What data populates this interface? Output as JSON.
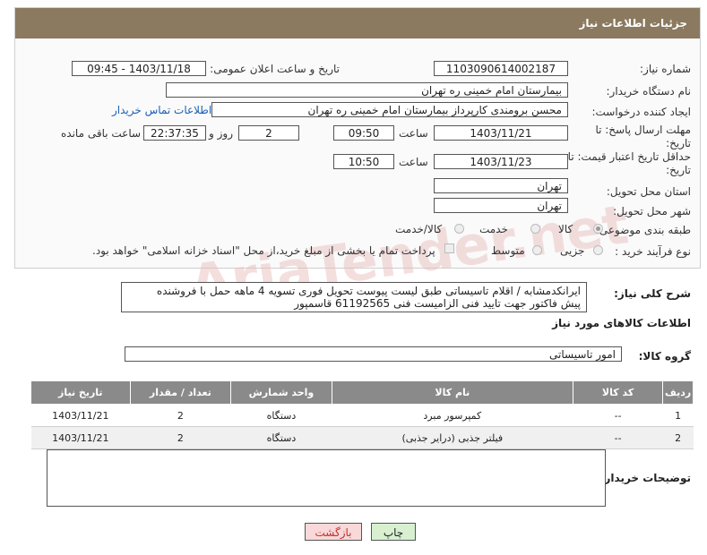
{
  "panel": {
    "title": "جزئیات اطلاعات نیاز"
  },
  "fields": {
    "need_number_label": "شماره نیاز:",
    "need_number": "1103090614002187",
    "announce_label": "تاریخ و ساعت اعلان عمومی:",
    "announce_value": "1403/11/18 - 09:45",
    "buyer_org_label": "نام دستگاه خریدار:",
    "buyer_org": "بیمارستان امام خمینی ره  تهران",
    "creator_label": "ایجاد کننده درخواست:",
    "creator": "محسن برومندی کارپرداز بیمارستان امام خمینی ره  تهران",
    "contact_link": "اطلاعات تماس خریدار",
    "deadline_label_1": "مهلت ارسال پاسخ: تا",
    "deadline_label_2": "تاریخ:",
    "deadline_date": "1403/11/21",
    "time_label": "ساعت",
    "deadline_time": "09:50",
    "days_value": "2",
    "days_label": "روز و",
    "remaining_time": "22:37:35",
    "remaining_label": "ساعت باقی مانده",
    "validity_label_1": "حداقل تاریخ اعتبار قیمت: تا",
    "validity_label_2": "تاریخ:",
    "validity_date": "1403/11/23",
    "validity_time": "10:50",
    "province_label": "استان محل تحویل:",
    "province": "تهران",
    "city_label": "شهر محل تحویل:",
    "city": "تهران",
    "category_label": "طبقه بندی موضوعی:",
    "category_options": [
      "کالا",
      "خدمت",
      "کالا/خدمت"
    ],
    "process_label": "نوع فرآیند خرید :",
    "process_options": [
      "جزیی",
      "متوسط"
    ],
    "payment_note": "پرداخت تمام یا بخشی از مبلغ خرید،از محل \"اسناد خزانه اسلامی\" خواهد بود."
  },
  "description": {
    "label": "شرح کلی نیاز:",
    "line1": "ایرانکدمشابه / اقلام تاسیساتی طبق لیست پیوست تحویل فوری تسویه 4 ماهه حمل با فروشنده",
    "line2": "پیش فاکتور جهت تایید فنی الزامیست فنی 61192565 قاسمپور"
  },
  "goods": {
    "section_title": "اطلاعات کالاهای مورد نیاز",
    "group_label": "گروه کالا:",
    "group_value": "امور تاسیساتی",
    "columns": [
      "ردیف",
      "کد کالا",
      "نام کالا",
      "واحد شمارش",
      "تعداد / مقدار",
      "تاریخ نیاز"
    ],
    "rows": [
      [
        "1",
        "--",
        "کمپرسور مبرد",
        "دستگاه",
        "2",
        "1403/11/21"
      ],
      [
        "2",
        "--",
        "فیلتر جذبی (درایر جذبی)",
        "دستگاه",
        "2",
        "1403/11/21"
      ]
    ]
  },
  "buyer_notes_label": "توضیحات خریدار:",
  "buttons": {
    "print": "چاپ",
    "back": "بازگشت"
  },
  "watermark": "AriaTender.net",
  "colors": {
    "header": "#8b7a5f",
    "table_header": "#8a8a8a",
    "link": "#1a5fb4",
    "print_bg": "#d8f0d0",
    "back_bg": "#f8d8d8"
  }
}
